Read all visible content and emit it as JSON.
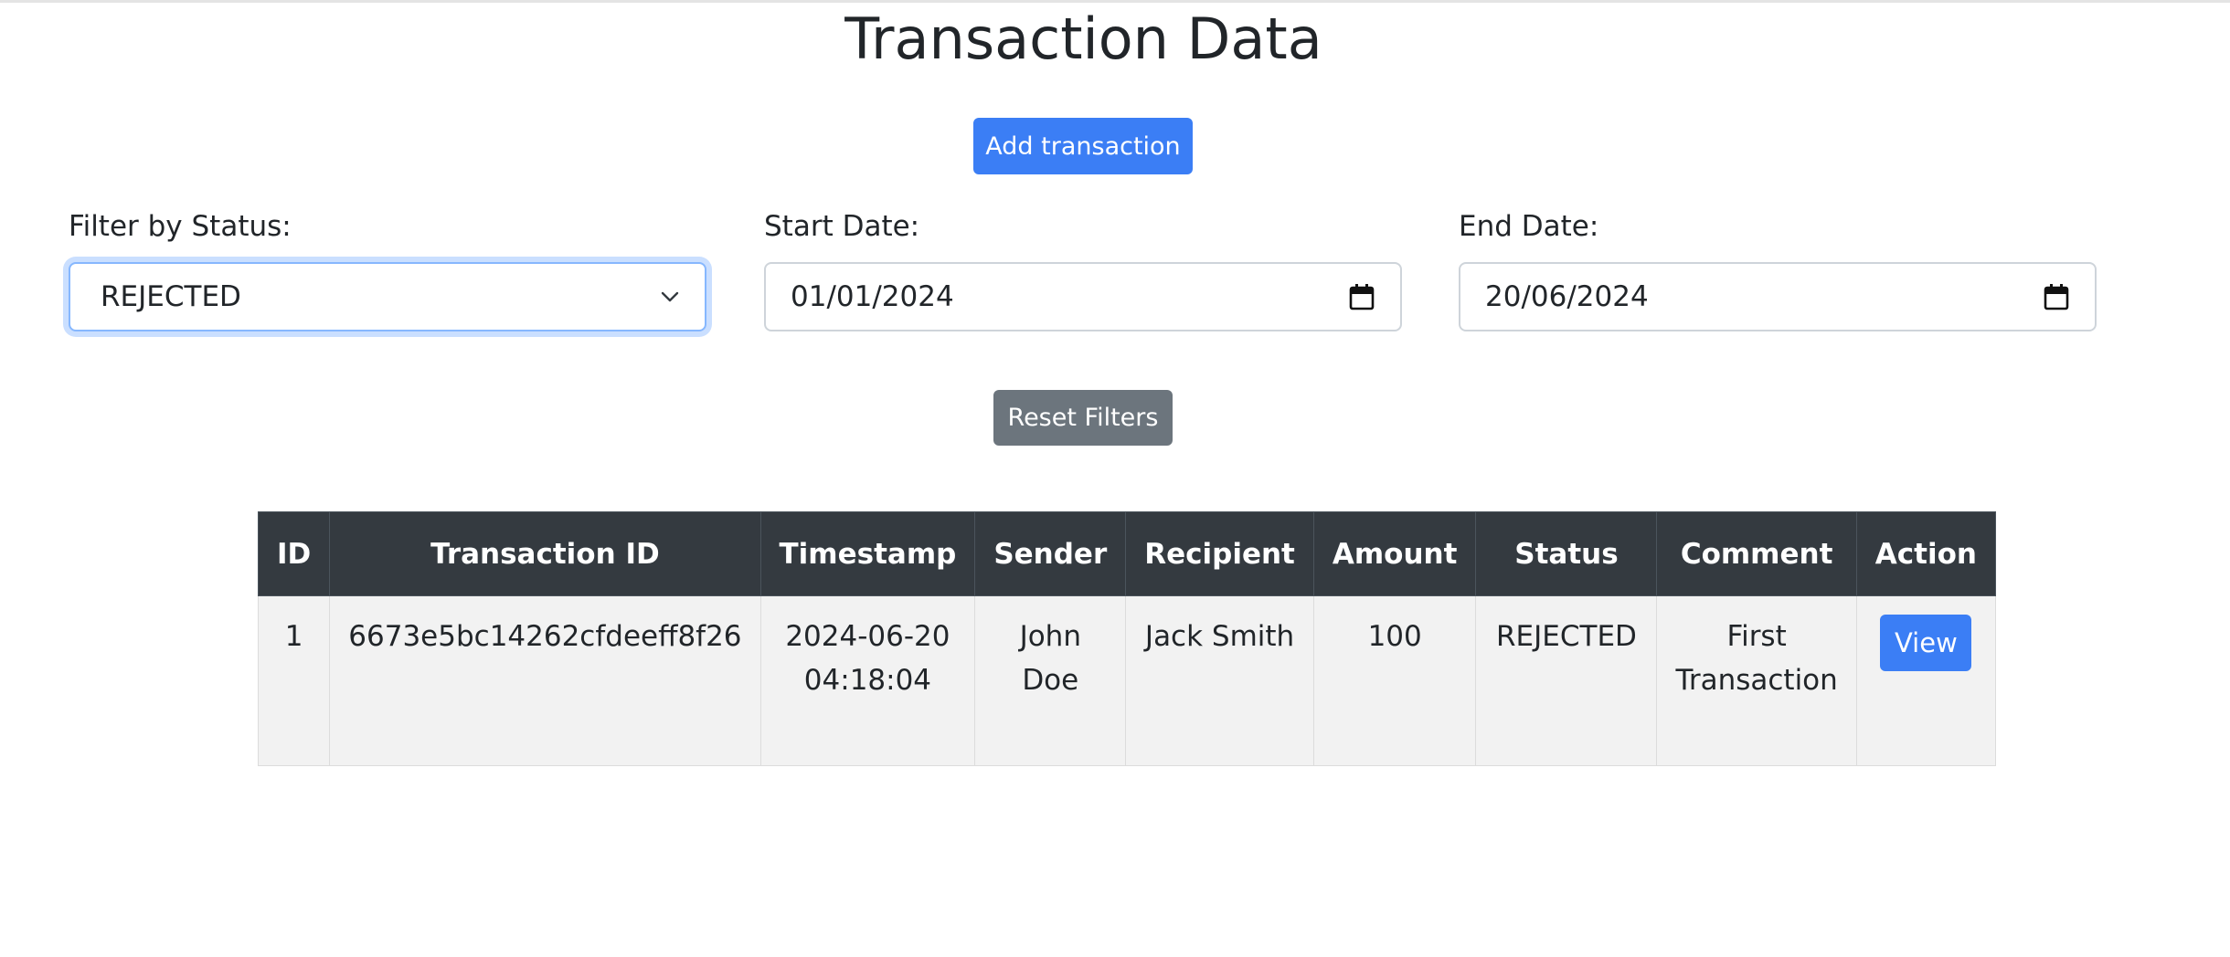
{
  "title": "Transaction Data",
  "add_button_label": "Add transaction",
  "filters": {
    "status_label": "Filter by Status:",
    "status_value": "REJECTED",
    "start_label": "Start Date:",
    "start_value": "01/01/2024",
    "end_label": "End Date:",
    "end_value": "20/06/2024"
  },
  "reset_button_label": "Reset Filters",
  "table": {
    "headers": [
      "ID",
      "Transaction ID",
      "Timestamp",
      "Sender",
      "Recipient",
      "Amount",
      "Status",
      "Comment",
      "Action"
    ],
    "rows": [
      {
        "id": "1",
        "transaction_id": "6673e5bc14262cfdeeff8f26",
        "timestamp": "2024-06-20 04:18:04",
        "sender": "John Doe",
        "recipient": "Jack Smith",
        "amount": "100",
        "status": "REJECTED",
        "comment": "First Transaction",
        "action": "View"
      }
    ]
  },
  "icons": {
    "select_chevron": "chevron-down-icon",
    "date_picker": "calendar-icon"
  },
  "colors": {
    "primary": "#3b7ef5",
    "secondary": "#6c757d",
    "table_header": "#343a40",
    "row_background": "#f2f2f2"
  }
}
